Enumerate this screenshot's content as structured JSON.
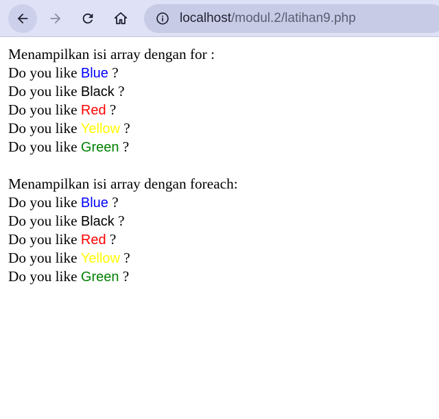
{
  "browser": {
    "url_host": "localhost",
    "url_path": "/modul.2/latihan9.php",
    "icons": {
      "back": "arrow-left-icon",
      "forward": "arrow-right-icon",
      "reload": "reload-icon",
      "home": "home-icon",
      "info": "info-icon"
    }
  },
  "page": {
    "section_for": {
      "heading": "Menampilkan isi array dengan for :",
      "lines": [
        {
          "prefix": "Do you like ",
          "color_name": "Blue",
          "color": "#0000ff",
          "suffix": " ?"
        },
        {
          "prefix": "Do you like ",
          "color_name": "Black",
          "color": "#000000",
          "suffix": " ?"
        },
        {
          "prefix": "Do you like ",
          "color_name": "Red",
          "color": "#ff0000",
          "suffix": " ?"
        },
        {
          "prefix": "Do you like ",
          "color_name": "Yellow",
          "color": "#ffff00",
          "suffix": " ?"
        },
        {
          "prefix": "Do you like ",
          "color_name": "Green",
          "color": "#008000",
          "suffix": " ?"
        }
      ]
    },
    "section_foreach": {
      "heading": "Menampilkan isi array dengan foreach:",
      "lines": [
        {
          "prefix": "Do you like ",
          "color_name": "Blue",
          "color": "#0000ff",
          "suffix": " ?"
        },
        {
          "prefix": "Do you like ",
          "color_name": "Black",
          "color": "#000000",
          "suffix": " ?"
        },
        {
          "prefix": "Do you like ",
          "color_name": "Red",
          "color": "#ff0000",
          "suffix": " ?"
        },
        {
          "prefix": "Do you like ",
          "color_name": "Yellow",
          "color": "#ffff00",
          "suffix": " ?"
        },
        {
          "prefix": "Do you like ",
          "color_name": "Green",
          "color": "#008000",
          "suffix": " ?"
        }
      ]
    }
  }
}
